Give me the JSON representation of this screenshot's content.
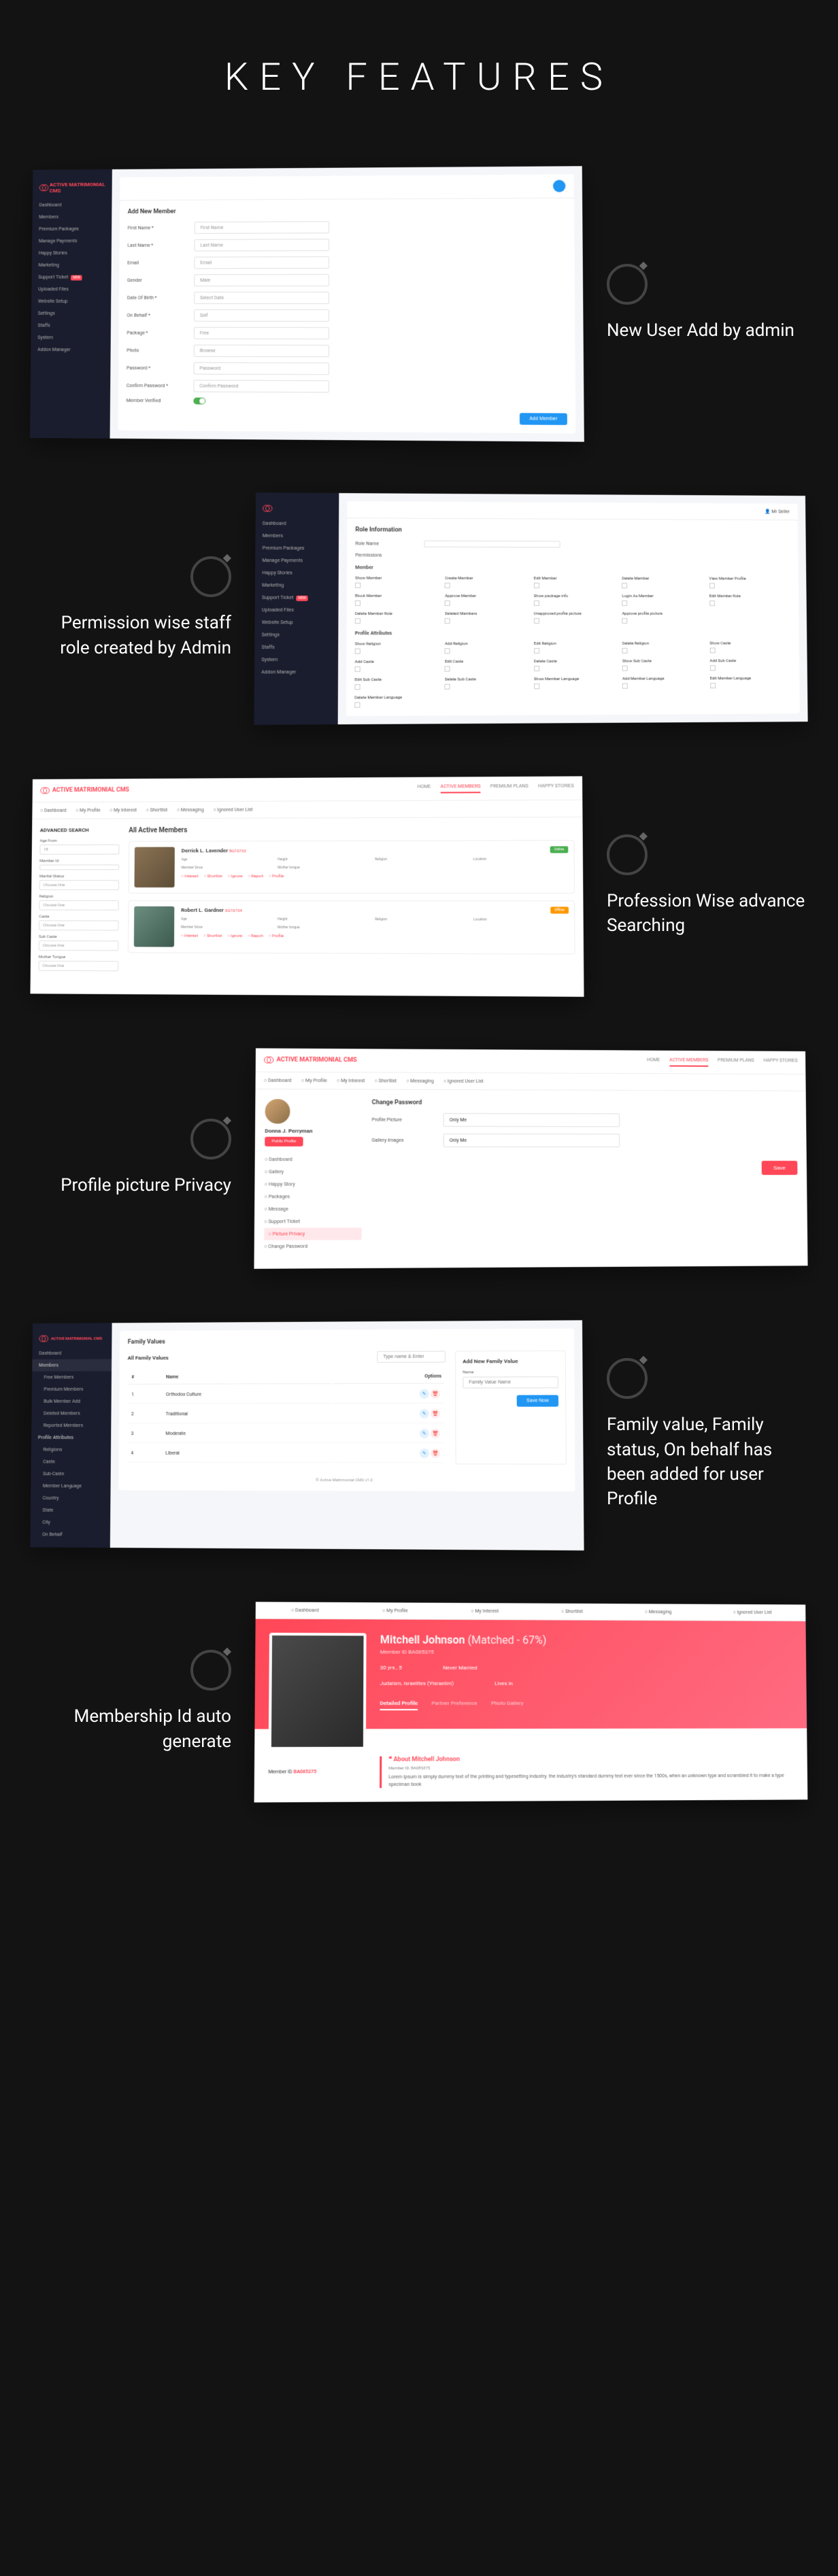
{
  "page_title": "KEY FEATURES",
  "captions": {
    "f1": "New User Add by admin",
    "f2": "Permission wise staff role created by Admin",
    "f3": "Profession Wise advance Searching",
    "f4": "Profile picture Privacy",
    "f5": "Family value, Family status, On behalf has been added for user Profile",
    "f6": "Membership Id auto generate"
  },
  "brand": "ACTIVE MATRIMONIAL CMS",
  "sidebar1": {
    "items": [
      "Dashboard",
      "Members",
      "Premium Packages",
      "Manage Payments",
      "Happy Stories",
      "Marketing",
      "Support Ticket",
      "Uploaded Files",
      "Website Setup",
      "Settings",
      "Staffs",
      "System",
      "Addon Manager"
    ],
    "new_badge": "NEW"
  },
  "form1": {
    "title": "Add New Member",
    "rows": [
      {
        "label": "First Name *",
        "value": "First Name"
      },
      {
        "label": "Last Name *",
        "value": "Last Name"
      },
      {
        "label": "Email",
        "value": "Email"
      },
      {
        "label": "Gender",
        "value": "Male"
      },
      {
        "label": "Date Of Birth *",
        "value": "Select Date"
      },
      {
        "label": "On Behalf *",
        "value": "Self"
      },
      {
        "label": "Package *",
        "value": "Free"
      },
      {
        "label": "Photo",
        "value": "Browse"
      },
      {
        "label": "Password *",
        "value": "Password"
      },
      {
        "label": "Confirm Password *",
        "value": "Confirm Password"
      },
      {
        "label": "Member Verified",
        "value": ""
      }
    ],
    "submit": "Add Member"
  },
  "form2": {
    "title": "Role Information",
    "role_label": "Role Name",
    "perm_label": "Permissions",
    "sections": [
      {
        "name": "Member",
        "items": [
          "Show Member",
          "Create Member",
          "Edit Member",
          "Delete Member",
          "View Member Profile",
          "Block Member",
          "Approve Member",
          "Show package info",
          "Login As Member",
          "Edit Member Role",
          "Delete Member Role",
          "Deleted Members",
          "Unapproved profile picture",
          "Approve profile picture"
        ]
      },
      {
        "name": "Profile Attributes",
        "items": [
          "Show Religion",
          "Add Religion",
          "Edit Religion",
          "Delete Religion",
          "Show Caste",
          "Add Caste",
          "Edit Caste",
          "Delete Caste",
          "Show Sub Caste",
          "Add Sub Caste",
          "Edit Sub Caste",
          "Delete Sub Caste",
          "Show Member Language",
          "Add Member Language",
          "Edit Member Language",
          "Delete Member Language"
        ]
      }
    ]
  },
  "front_nav": [
    "HOME",
    "ACTIVE MEMBERS",
    "PREMIUM PLANS",
    "HAPPY STORIES"
  ],
  "front_subnav": [
    "Dashboard",
    "My Profile",
    "My Interest",
    "Shortlist",
    "Messaging",
    "Ignored User List"
  ],
  "search3": {
    "title": "ADVANCED SEARCH",
    "filters": [
      {
        "label": "Age From",
        "value": "18"
      },
      {
        "label": "Member Id",
        "value": ""
      },
      {
        "label": "Marital Status",
        "value": "Choose One"
      },
      {
        "label": "Religion",
        "value": "Choose One"
      },
      {
        "label": "Caste",
        "value": "Choose One"
      },
      {
        "label": "Sub Caste",
        "value": "Choose One"
      },
      {
        "label": "Mother Tongue",
        "value": "Choose One"
      }
    ],
    "list_title": "All Active Members",
    "members": [
      {
        "name": "Derrick L. Lavender",
        "id": "BG1S733",
        "status": "Online",
        "stats": [
          "Age",
          "Height",
          "Religion",
          "Location",
          "Member Since",
          "Mother tongue"
        ]
      },
      {
        "name": "Robert L. Gardner",
        "id": "DG1S734",
        "status": "Offline",
        "stats": [
          "Age",
          "Height",
          "Religion",
          "Location",
          "Member Since",
          "Mother tongue"
        ]
      }
    ],
    "actions": [
      "Interest",
      "Shortlist",
      "Ignore",
      "Report",
      "Profile"
    ]
  },
  "privacy4": {
    "user": "Donna J. Perryman",
    "public_btn": "Public Profile",
    "menu": [
      "Dashboard",
      "Gallery",
      "Happy Story",
      "Packages",
      "Message",
      "Support Ticket",
      "Picture Privacy",
      "Change Password"
    ],
    "title": "Change Password",
    "rows": [
      {
        "label": "Profile Picture",
        "value": "Only Me"
      },
      {
        "label": "Gallery Images",
        "value": "Only Me"
      }
    ],
    "save": "Save"
  },
  "fv5": {
    "title": "Family Values",
    "list_title": "All Family Values",
    "search_ph": "Type name & Enter",
    "cols": [
      "#",
      "Name",
      "Options"
    ],
    "rows": [
      {
        "n": "1",
        "name": "Orthodox Culture"
      },
      {
        "n": "2",
        "name": "Traditional"
      },
      {
        "n": "3",
        "name": "Moderate"
      },
      {
        "n": "4",
        "name": "Liberal"
      }
    ],
    "add_title": "Add New Family Value",
    "add_label": "Name",
    "add_ph": "Family Value Name",
    "save": "Save Now",
    "footer": "© Active Matrimonial CMS v1.0",
    "sidebar_extra": [
      "Free Members",
      "Premium Members",
      "Bulk Member Add",
      "Deleted Members",
      "Reported Members"
    ],
    "pa_title": "Profile Attributes",
    "pa_items": [
      "Religions",
      "Caste",
      "Sub-Caste",
      "Member Language",
      "Country",
      "State",
      "City",
      "On Behalf"
    ]
  },
  "prof6": {
    "name": "Mitchell Johnson",
    "match": "(Matched - 67%)",
    "id_label": "Member ID",
    "id": "BA085375",
    "stats": [
      {
        "l": "30 yrs , 5",
        "r": "Never Married"
      },
      {
        "l": "Judaism, Israelites (Yisraelim)",
        "r": "Lives in"
      }
    ],
    "tabs": [
      "Detailed Profile",
      "Partner Preference",
      "Photo Gallery"
    ],
    "about_title": "About Mitchell Johnson",
    "about_sub": "Member ID: BA085375",
    "about_text": "Lorem ipsum is simply dummy text of the printing and typesetting industry. the industry's standard dummy text ever since the 1500s, when an unknown type and scrambled it to make a type speciman book",
    "badge_label": "Member ID",
    "badge_val": "BA085375"
  }
}
